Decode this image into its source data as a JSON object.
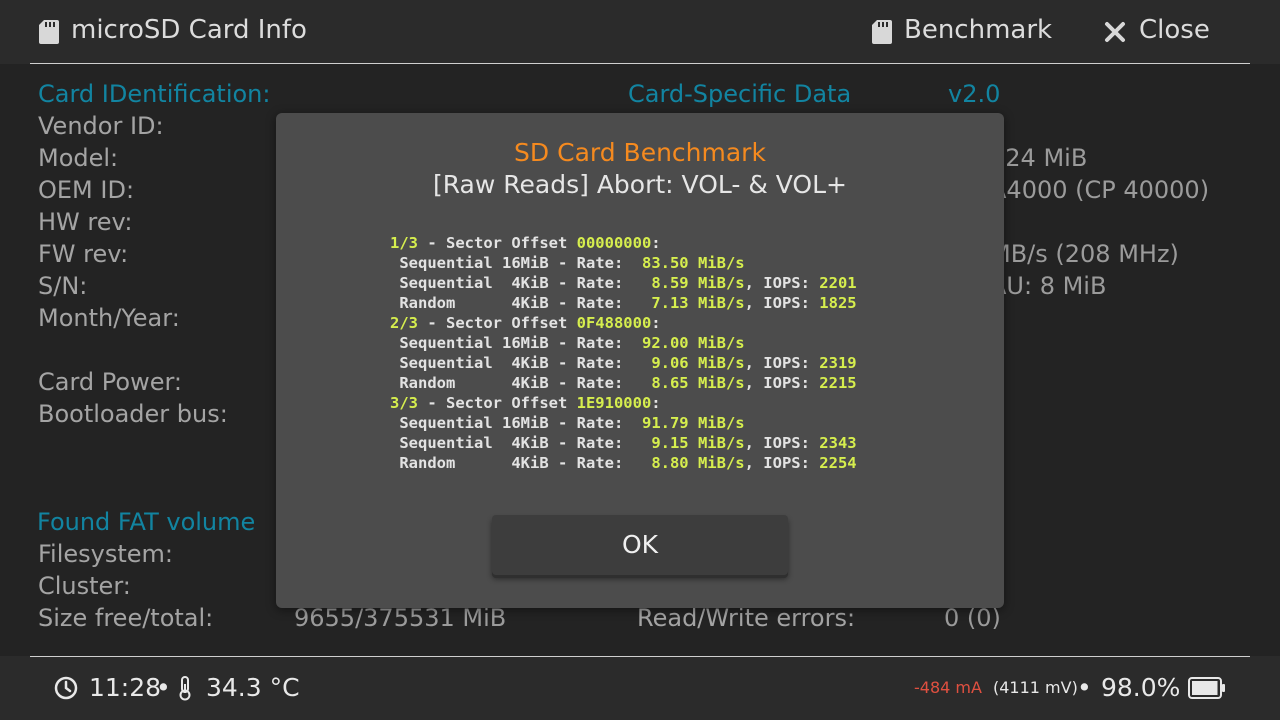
{
  "header": {
    "title": "microSD Card Info",
    "benchmark_label": "Benchmark",
    "close_label": "Close",
    "sd_icon": "sd-card-icon",
    "close_icon": "x-icon"
  },
  "left": {
    "cid_header": "Card IDentification:",
    "vendor_id": "Vendor ID:",
    "model": "Model:",
    "oem_id": "OEM ID:",
    "hw_rev": "HW rev:",
    "fw_rev": "FW rev:",
    "sn": "S/N:",
    "month_year": "Month/Year:",
    "card_power": "Card Power:",
    "bootloader_bus": "Bootloader bus:",
    "fat_header": "Found FAT volume",
    "filesystem": "Filesystem:",
    "cluster": "Cluster:",
    "size_label": "Size free/total:",
    "size_value": "9655/375531 MiB"
  },
  "right": {
    "csd_header": "Card-Specific Data",
    "csd_version": "v2.0",
    "capacity_partial": "624 MiB",
    "class_partial": "A4000 (CP 40000)",
    "speed_partial": "MB/s (208 MHz)",
    "au_partial": "AU: 8 MiB",
    "bus_partial": "e",
    "rw_errors_label": "Read/Write errors:",
    "rw_errors_value": "0 (0)"
  },
  "modal": {
    "title": "SD Card Benchmark",
    "subtitle": "[Raw Reads] Abort: VOL- & VOL+",
    "ok_label": "OK",
    "passes": [
      {
        "index": "1/3",
        "label": " - Sector Offset ",
        "offset": "00000000",
        "tests": [
          {
            "name": "Sequential 16MiB",
            "rate": "83.50 MiB/s",
            "iops": ""
          },
          {
            "name": "Sequential  4KiB",
            "rate": " 8.59 MiB/s",
            "iops": "2201"
          },
          {
            "name": "Random      4KiB",
            "rate": " 7.13 MiB/s",
            "iops": "1825"
          }
        ]
      },
      {
        "index": "2/3",
        "label": " - Sector Offset ",
        "offset": "0F488000",
        "tests": [
          {
            "name": "Sequential 16MiB",
            "rate": "92.00 MiB/s",
            "iops": ""
          },
          {
            "name": "Sequential  4KiB",
            "rate": " 9.06 MiB/s",
            "iops": "2319"
          },
          {
            "name": "Random      4KiB",
            "rate": " 8.65 MiB/s",
            "iops": "2215"
          }
        ]
      },
      {
        "index": "3/3",
        "label": " - Sector Offset ",
        "offset": "1E910000",
        "tests": [
          {
            "name": "Sequential 16MiB",
            "rate": "91.79 MiB/s",
            "iops": ""
          },
          {
            "name": "Sequential  4KiB",
            "rate": " 9.15 MiB/s",
            "iops": "2343"
          },
          {
            "name": "Random      4KiB",
            "rate": " 8.80 MiB/s",
            "iops": "2254"
          }
        ]
      }
    ]
  },
  "footer": {
    "time": "11:28",
    "temperature": "34.3 °C",
    "separator": "•",
    "current": "-484 mA",
    "voltage": "(4111 mV)",
    "battery_pct": "98.0%",
    "battery_level": 0.98
  },
  "colors": {
    "section": "#16a2c5",
    "modal_title": "#f58a1f",
    "highlight": "#d6ee4e",
    "current": "#e05040"
  }
}
